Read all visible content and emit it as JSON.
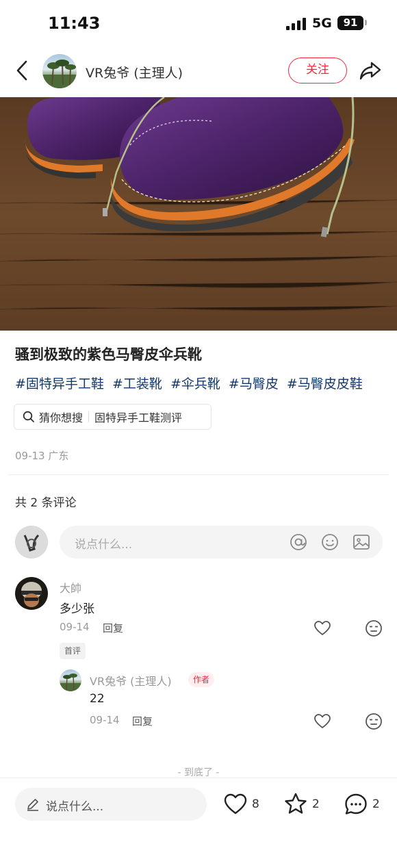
{
  "status_bar": {
    "time": "11:43",
    "network": "5G",
    "battery": "91"
  },
  "header": {
    "author_name": "VR兔爷 (主理人)",
    "follow_label": "关注"
  },
  "post": {
    "title": "骚到极致的紫色马臀皮伞兵靴",
    "tags": [
      "#固特异手工鞋",
      "#工装靴",
      "#伞兵靴",
      "#马臀皮",
      "#马臀皮皮鞋"
    ],
    "search_suggest": {
      "prefix": "猜你想搜",
      "query": "固特异手工鞋测评"
    },
    "meta": "09-13 广东"
  },
  "comments_section": {
    "count_label": "共 2 条评论",
    "input_placeholder": "说点什么...",
    "end_label": "- 到底了 -",
    "comments": [
      {
        "name": "大帥",
        "text": "多少张",
        "date": "09-14",
        "reply_label": "回复",
        "badge": "首评"
      },
      {
        "name": "VR兔爷 (主理人)",
        "text": "22",
        "date": "09-14",
        "reply_label": "回复",
        "badge": "作者"
      }
    ]
  },
  "bottom_bar": {
    "input_placeholder": "说点什么...",
    "likes": "8",
    "collects": "2",
    "comments": "2"
  },
  "colors": {
    "accent": "#ff2442",
    "tag": "#13386c"
  }
}
